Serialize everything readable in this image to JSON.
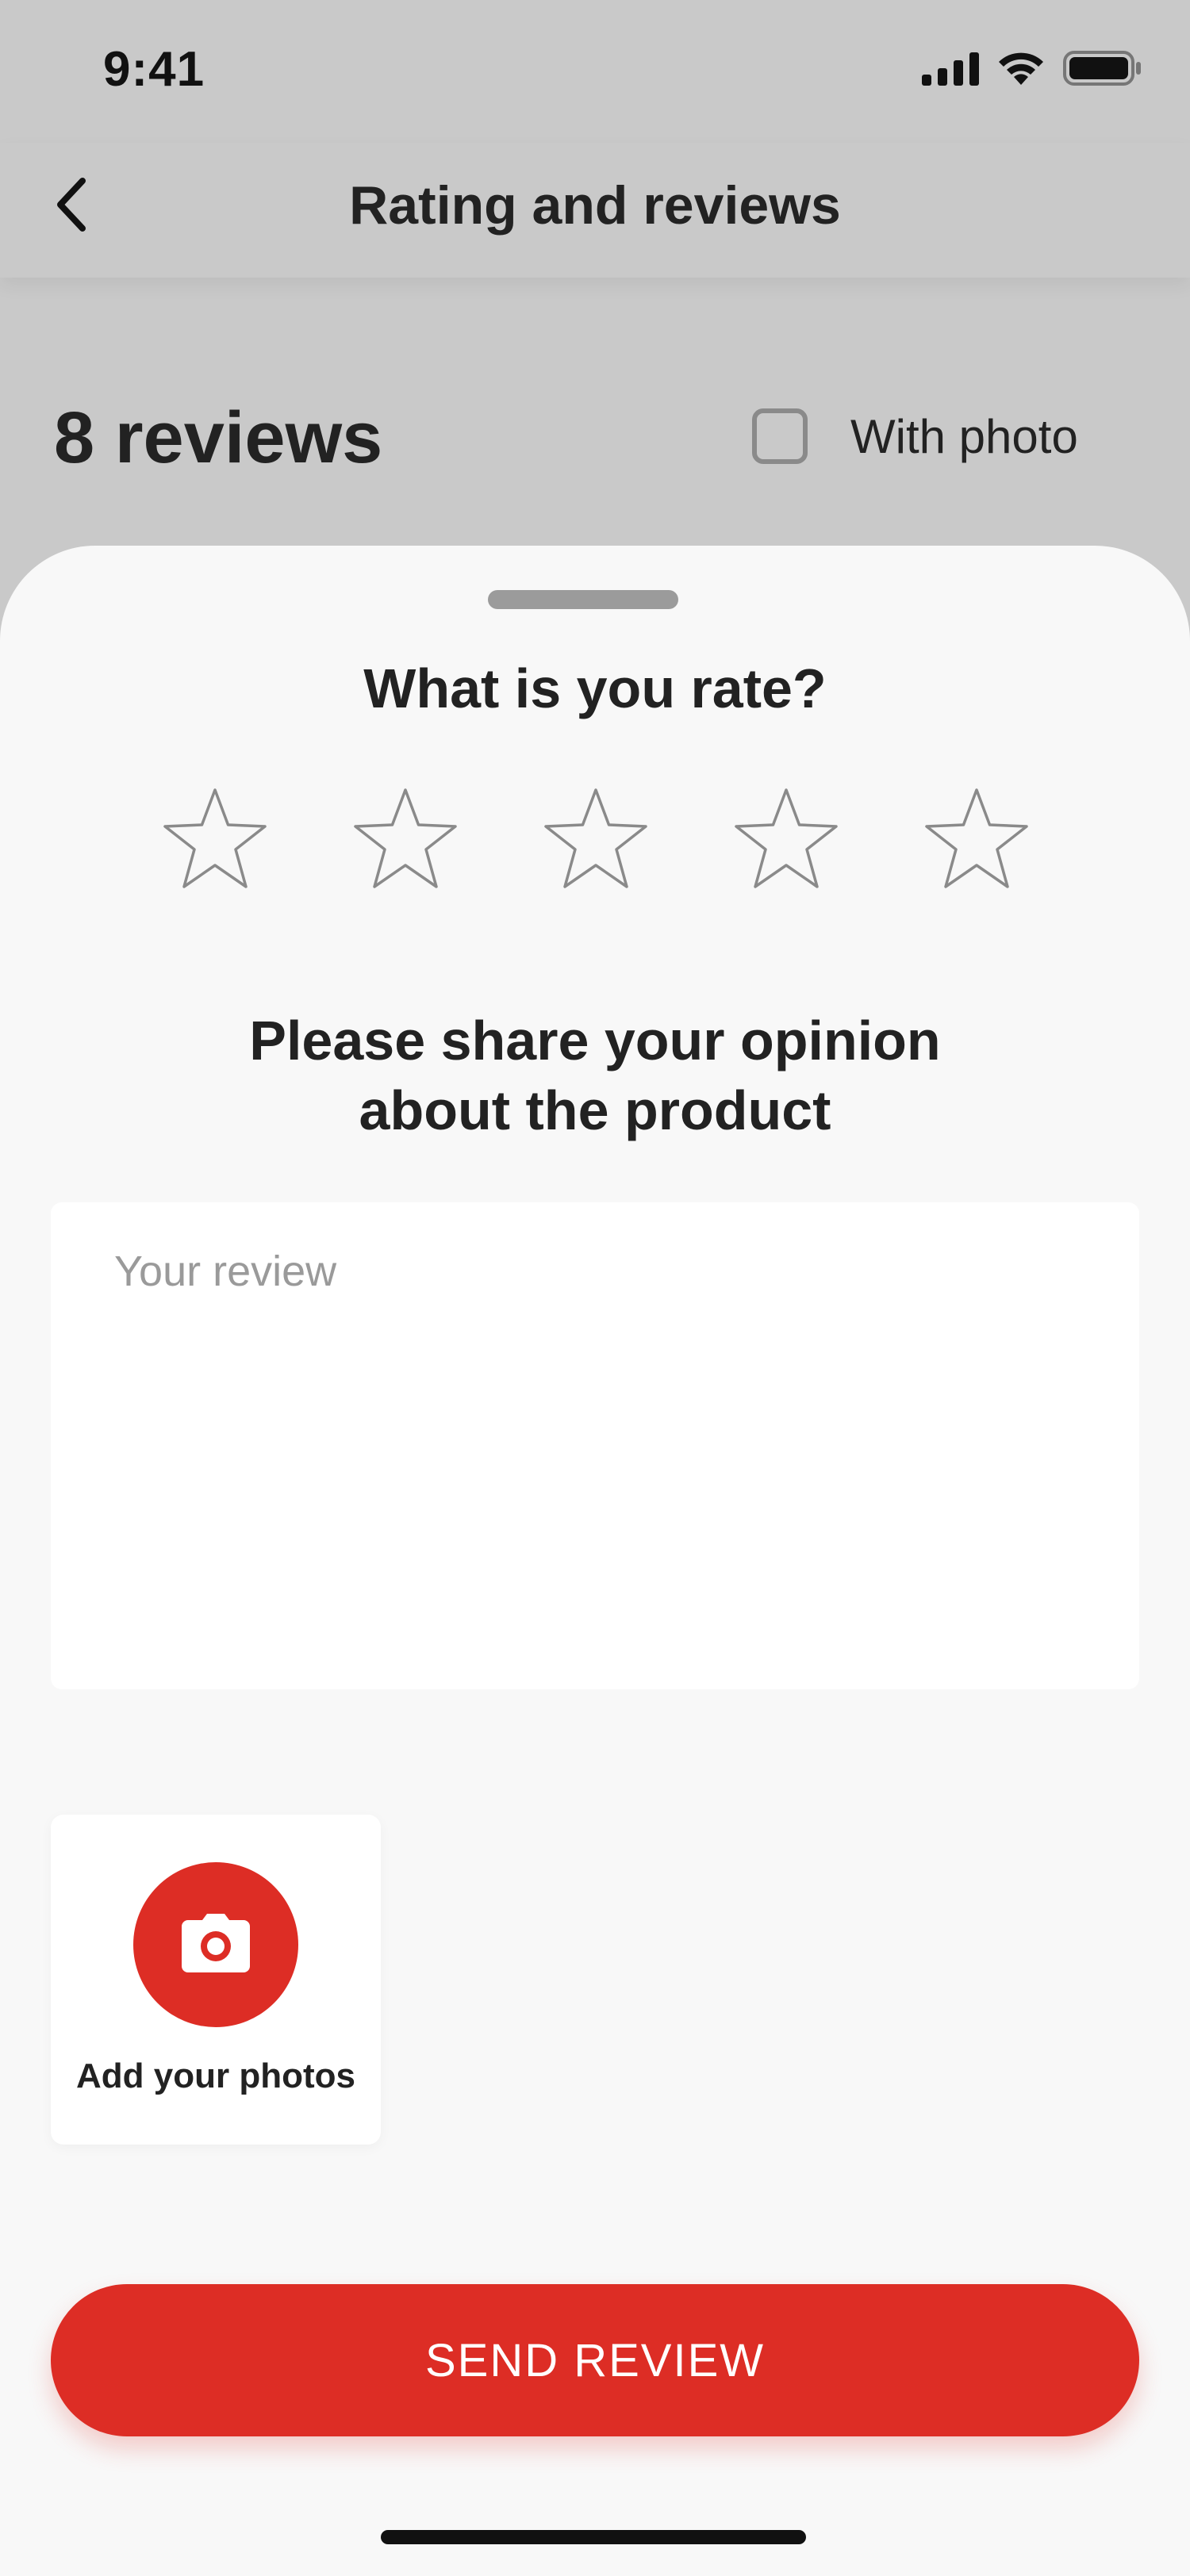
{
  "status_bar": {
    "time": "9:41",
    "icons": [
      "signal-icon",
      "wifi-icon",
      "battery-icon"
    ]
  },
  "header": {
    "title": "Rating and reviews",
    "back_icon": "chevron-left-icon"
  },
  "reviews": {
    "count_label": "8 reviews",
    "filter_label": "With photo",
    "filter_checked": false
  },
  "sheet": {
    "rate_heading": "What is you rate?",
    "rating": {
      "value": 0,
      "max": 5
    },
    "opinion_line1": "Please share your opinion",
    "opinion_line2": "about the product",
    "review_placeholder": "Your review",
    "review_value": "",
    "add_photos_label": "Add your photos",
    "add_photos_icon": "camera-icon",
    "send_label": "SEND REVIEW"
  },
  "colors": {
    "accent": "#dd2d25",
    "overlay": "#c9c9c9",
    "sheet_background": "#f8f8f8",
    "text": "#222222",
    "star_outline": "#8a8a8a"
  }
}
